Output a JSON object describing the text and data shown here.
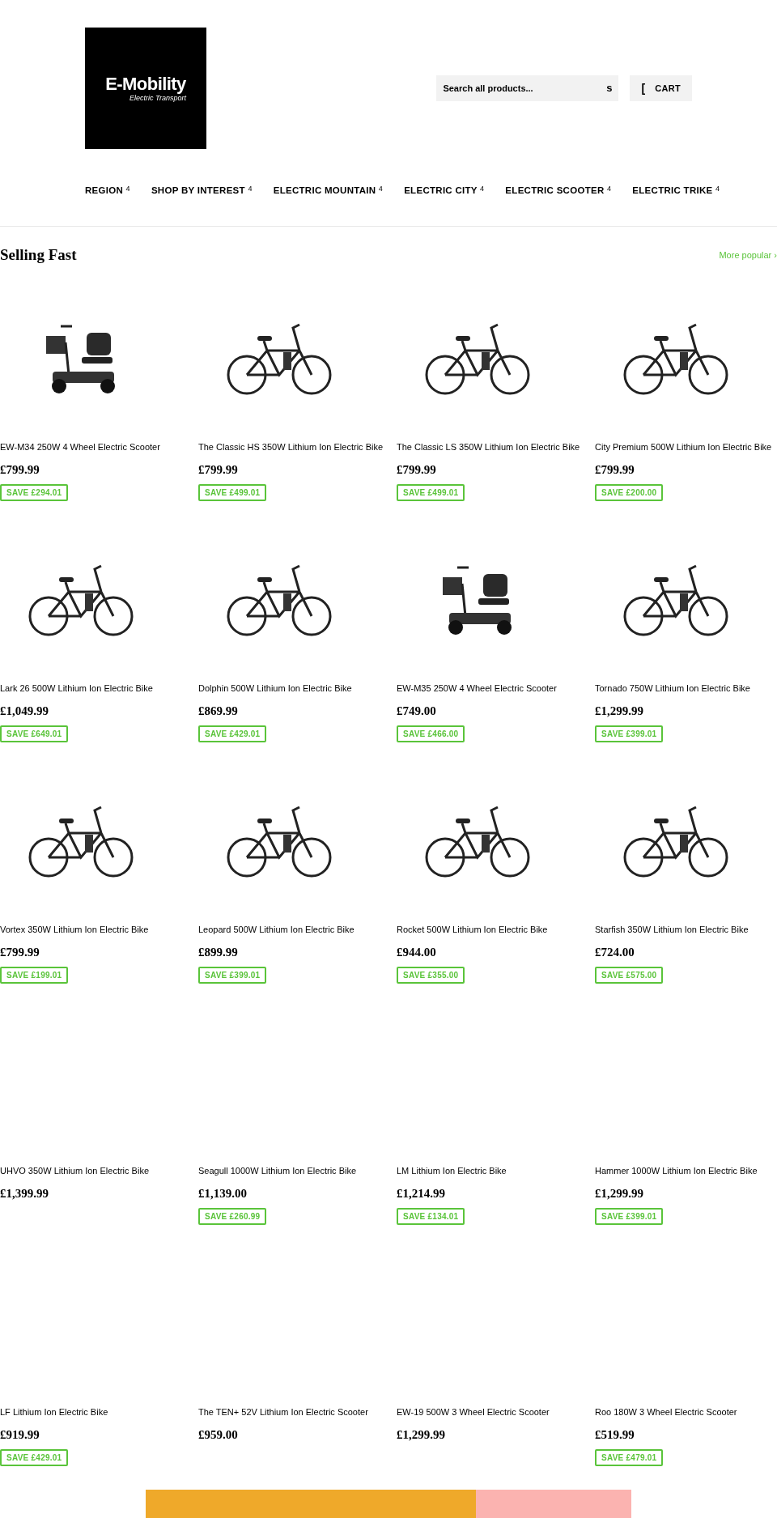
{
  "header": {
    "logo": {
      "title": "E-Mobility",
      "subtitle": "Electric Transport"
    },
    "search": {
      "placeholder": "Search all products...",
      "icon_glyph": "s"
    },
    "cart": {
      "icon_glyph": "[",
      "label": "CART"
    }
  },
  "nav": [
    {
      "label": "REGION",
      "caret": "4"
    },
    {
      "label": "SHOP BY INTEREST",
      "caret": "4"
    },
    {
      "label": "ELECTRIC MOUNTAIN",
      "caret": "4"
    },
    {
      "label": "ELECTRIC CITY",
      "caret": "4"
    },
    {
      "label": "ELECTRIC SCOOTER",
      "caret": "4"
    },
    {
      "label": "ELECTRIC TRIKE",
      "caret": "4"
    }
  ],
  "section": {
    "title": "Selling Fast",
    "more_link": "More popular ›"
  },
  "products": [
    {
      "kind": "scooter",
      "title": "EW-M34 250W 4 Wheel Electric Scooter",
      "price": "£799.99",
      "save": "SAVE £294.01"
    },
    {
      "kind": "bike",
      "title": "The Classic HS 350W Lithium Ion Electric Bike",
      "price": "£799.99",
      "save": "SAVE £499.01"
    },
    {
      "kind": "bike",
      "title": "The Classic LS 350W Lithium Ion Electric Bike",
      "price": "£799.99",
      "save": "SAVE £499.01"
    },
    {
      "kind": "bike",
      "title": "City Premium 500W Lithium Ion Electric Bike",
      "price": "£799.99",
      "save": "SAVE £200.00"
    },
    {
      "kind": "bike",
      "title": "Lark 26 500W Lithium Ion Electric Bike",
      "price": "£1,049.99",
      "save": "SAVE £649.01"
    },
    {
      "kind": "bike",
      "title": "Dolphin 500W Lithium Ion Electric Bike",
      "price": "£869.99",
      "save": "SAVE £429.01"
    },
    {
      "kind": "scooter",
      "title": "EW-M35 250W 4 Wheel Electric Scooter",
      "price": "£749.00",
      "save": "SAVE £466.00"
    },
    {
      "kind": "bike",
      "title": "Tornado 750W Lithium Ion Electric Bike",
      "price": "£1,299.99",
      "save": "SAVE £399.01"
    },
    {
      "kind": "bike",
      "title": "Vortex 350W Lithium Ion Electric Bike",
      "price": "£799.99",
      "save": "SAVE £199.01"
    },
    {
      "kind": "bike",
      "title": "Leopard 500W Lithium Ion Electric Bike",
      "price": "£899.99",
      "save": "SAVE £399.01"
    },
    {
      "kind": "bike",
      "title": "Rocket 500W Lithium Ion Electric Bike",
      "price": "£944.00",
      "save": "SAVE £355.00"
    },
    {
      "kind": "bike",
      "title": "Starfish 350W Lithium Ion Electric Bike",
      "price": "£724.00",
      "save": "SAVE £575.00"
    },
    {
      "kind": "none",
      "title": "UHVO 350W Lithium Ion Electric Bike",
      "price": "£1,399.99"
    },
    {
      "kind": "none",
      "title": "Seagull 1000W Lithium Ion Electric Bike",
      "price": "£1,139.00",
      "save": "SAVE £260.99"
    },
    {
      "kind": "none",
      "title": "LM Lithium Ion Electric Bike",
      "price": "£1,214.99",
      "save": "SAVE £134.01"
    },
    {
      "kind": "none",
      "title": "Hammer 1000W Lithium Ion Electric Bike",
      "price": "£1,299.99",
      "save": "SAVE £399.01"
    },
    {
      "kind": "none",
      "title": "LF Lithium Ion Electric Bike",
      "price": "£919.99",
      "save": "SAVE £429.01"
    },
    {
      "kind": "none",
      "title": "The TEN+ 52V Lithium Ion Electric Scooter",
      "price": "£959.00"
    },
    {
      "kind": "none",
      "title": "EW-19 500W 3 Wheel Electric Scooter",
      "price": "£1,299.99"
    },
    {
      "kind": "none",
      "title": "Roo 180W 3 Wheel Electric Scooter",
      "price": "£519.99",
      "save": "SAVE £479.01"
    }
  ]
}
